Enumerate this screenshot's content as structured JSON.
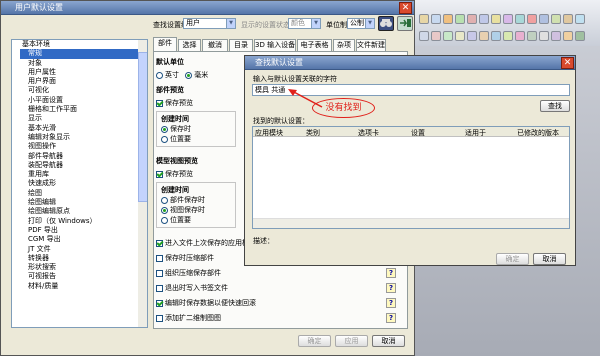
{
  "main_dialog": {
    "title": "用户默认设置",
    "search_label": "查找设置级别",
    "level_value": "用户",
    "display_label": "显示的设置状态",
    "display_value": "颜色",
    "unit_label": "单位制",
    "unit_value": "公制"
  },
  "tree": {
    "items": [
      "基本环境",
      "常规",
      "对象",
      "用户属性",
      "用户界面",
      "可视化",
      "小平面设置",
      "栅格和工作平面",
      "显示",
      "基本光滑",
      "编辑对象显示",
      "视图操作",
      "部件导航器",
      "装配导航器",
      "重用库",
      "快速成形",
      "绘图",
      "绘图编辑",
      "绘图编辑原点",
      "打印（仅 Windows）",
      "PDF 导出",
      "CGM 导出",
      "JT 文件",
      "转换器",
      "形状搜索",
      "可视报告",
      "材料/质量"
    ]
  },
  "tabs": [
    "部件",
    "选择",
    "撤消",
    "目录",
    "3D 输入设备",
    "电子表格",
    "杂项",
    "文件新建"
  ],
  "settings": {
    "units_title": "默认单位",
    "unit_inch": "英寸",
    "unit_mm": "毫米",
    "preview_title": "部件预览",
    "save_preview": "保存预览",
    "create_time": "创建时间",
    "save_time": "保存时",
    "on_demand": "位置要",
    "model_preview_title": "模型视图预览",
    "model_save_preview": "保存预览",
    "part_save_time": "部件保存时",
    "view_save_time": "视图保存时",
    "model_on_demand": "位置要"
  },
  "checkboxes": [
    "进入文件上次保存的应用模块",
    "保存时压缩部件",
    "组织压缩保存部件",
    "退出时写入书签文件",
    "编辑时保存数据以便快速回滚",
    "添加扩二维制图图"
  ],
  "main_buttons": {
    "ok": "确定",
    "apply": "应用",
    "cancel": "取消"
  },
  "find_dialog": {
    "title": "查找默认设置",
    "prompt": "输入与默认设置关联的字符",
    "query": "模具 共通",
    "find_button": "查找",
    "found_label": "找到的默认设置：",
    "columns": [
      "应用模块",
      "类别",
      "选项卡",
      "设置",
      "适用于",
      "已修改的版本"
    ],
    "desc_label": "描述：",
    "ok": "确定",
    "cancel": "取消"
  },
  "annotation": {
    "text": "没有找到",
    "color": "#e0201a"
  }
}
